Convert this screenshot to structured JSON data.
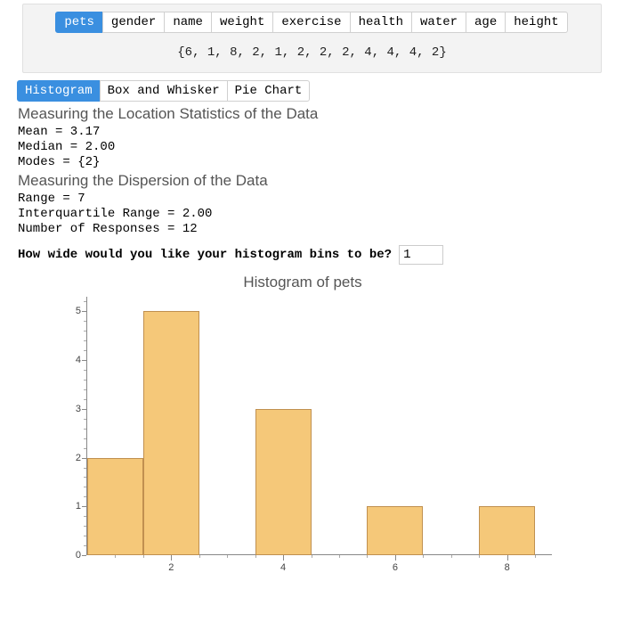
{
  "variable_tabs": [
    "pets",
    "gender",
    "name",
    "weight",
    "exercise",
    "health",
    "water",
    "age",
    "height"
  ],
  "active_variable_index": 0,
  "raw_data_display": "{6, 1, 8, 2, 1, 2, 2, 2, 4, 4, 4, 2}",
  "chart_type_tabs": [
    "Histogram",
    "Box and Whisker",
    "Pie Chart"
  ],
  "active_chart_type_index": 0,
  "location_heading": "Measuring the Location Statistics of the Data",
  "mean_line": "Mean = 3.17",
  "median_line": "Median = 2.00",
  "modes_line": "Modes = {2}",
  "dispersion_heading": "Measuring the Dispersion of the Data",
  "range_line": "Range = 7",
  "iqr_line": "Interquartile Range = 2.00",
  "n_line": "Number of Responses = 12",
  "bin_prompt": "How wide would you like your histogram bins to be?",
  "bin_value": "1",
  "chart_title": "Histogram of pets",
  "chart_data": {
    "type": "bar",
    "title": "Histogram of pets",
    "xlabel": "",
    "ylabel": "",
    "x_ticks_major": [
      2,
      4,
      6,
      8
    ],
    "y_ticks_major": [
      0,
      1,
      2,
      3,
      4,
      5
    ],
    "xlim": [
      0.5,
      8.8
    ],
    "ylim": [
      0,
      5.3
    ],
    "bin_width": 1,
    "bars": [
      {
        "left": 0.5,
        "right": 1.5,
        "height": 2
      },
      {
        "left": 1.5,
        "right": 2.5,
        "height": 5
      },
      {
        "left": 3.5,
        "right": 4.5,
        "height": 3
      },
      {
        "left": 5.5,
        "right": 6.5,
        "height": 1
      },
      {
        "left": 7.5,
        "right": 8.5,
        "height": 1
      }
    ]
  }
}
